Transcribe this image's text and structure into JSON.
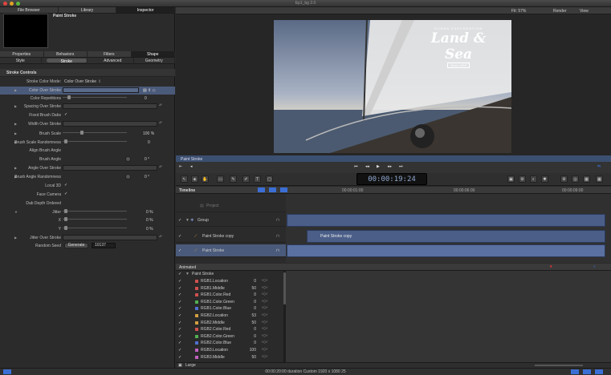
{
  "window": {
    "title": "Ep1_bg 2.0"
  },
  "left_tabs": [
    "File Browser",
    "Library",
    "Inspector"
  ],
  "object": {
    "name": "Paint Stroke"
  },
  "inspector_tabs": [
    "Properties",
    "Behaviors",
    "Filters",
    "Shape"
  ],
  "shape_subtabs": [
    "Style",
    "Stroke",
    "Advanced",
    "Geometry"
  ],
  "section": {
    "title": "Stroke Controls"
  },
  "params": [
    {
      "label": "Stroke Color Mode:",
      "value": "Color Over Stroke"
    },
    {
      "label": "Color Over Stroke"
    },
    {
      "label": "Color Repetitions",
      "value": "0"
    },
    {
      "label": "Spacing Over Stroke"
    },
    {
      "label": "Fixed Brush Dabs"
    },
    {
      "label": "Width Over Stroke"
    },
    {
      "label": "Brush Scale",
      "value": "100 %"
    },
    {
      "label": "Brush Scale Randomness",
      "value": "0"
    },
    {
      "label": "Align Brush Angle"
    },
    {
      "label": "Brush Angle",
      "value": "0 °"
    },
    {
      "label": "Angle Over Stroke"
    },
    {
      "label": "Brush Angle Randomness",
      "value": "0 °"
    },
    {
      "label": "Local 3D"
    },
    {
      "label": "Face Camera"
    },
    {
      "label": "Dab Depth Ordered"
    },
    {
      "label": "Jitter",
      "value": "0 %"
    },
    {
      "label": "X",
      "value": "0 %"
    },
    {
      "label": "Y",
      "value": "0 %"
    },
    {
      "label": "Jitter Over Stroke"
    },
    {
      "label": "Random Seed",
      "button": "Generate",
      "value": "10137"
    }
  ],
  "viewer": {
    "menu_right": [
      "Fit: 57%",
      "Render",
      "View"
    ]
  },
  "photo": {
    "brand_small": "OCEAN EXPLORATION",
    "brand_big": "Land & Sea",
    "brand_since": "Since 1893"
  },
  "scrub_label": "Paint Stroke",
  "timecode": "00:00:19:24",
  "timeline": {
    "title": "Timeline",
    "ruler": [
      "00:00:01:00",
      "00:00:06:00",
      "00:00:09:00"
    ],
    "rows": [
      "Project",
      "Group",
      "Paint Stroke copy",
      "Paint Stroke"
    ],
    "clip_label": "Paint Stroke copy"
  },
  "animation": {
    "title": "Animated",
    "group": "Paint Stroke",
    "rows": [
      {
        "name": "RGB1.Location",
        "value": "0",
        "color": "#d05050"
      },
      {
        "name": "RGB1.Middle",
        "value": "50",
        "color": "#d05050"
      },
      {
        "name": "RGB1.Color.Red",
        "value": "0",
        "color": "#d05050"
      },
      {
        "name": "RGB1.Color.Green",
        "value": "0",
        "color": "#50b050"
      },
      {
        "name": "RGB1.Color.Blue",
        "value": "0",
        "color": "#5070d0"
      },
      {
        "name": "RGB2.Location",
        "value": "53",
        "color": "#d0a040"
      },
      {
        "name": "RGB2.Middle",
        "value": "50",
        "color": "#d0a040"
      },
      {
        "name": "RGB2.Color.Red",
        "value": "0",
        "color": "#d05050"
      },
      {
        "name": "RGB2.Color.Green",
        "value": "0",
        "color": "#50b050"
      },
      {
        "name": "RGB2.Color.Blue",
        "value": "0",
        "color": "#5070d0"
      },
      {
        "name": "RGB3.Location",
        "value": "100",
        "color": "#c060c0"
      },
      {
        "name": "RGB3.Middle",
        "value": "50",
        "color": "#c060c0"
      }
    ],
    "footer_size": "Large"
  },
  "status": {
    "text": "00:00:20:00 duration Custom 1920 x 1080 25"
  },
  "colors": {
    "selection": "#4a5a7a",
    "clip": "#4a5e88",
    "accent": "#3b6fd6"
  }
}
